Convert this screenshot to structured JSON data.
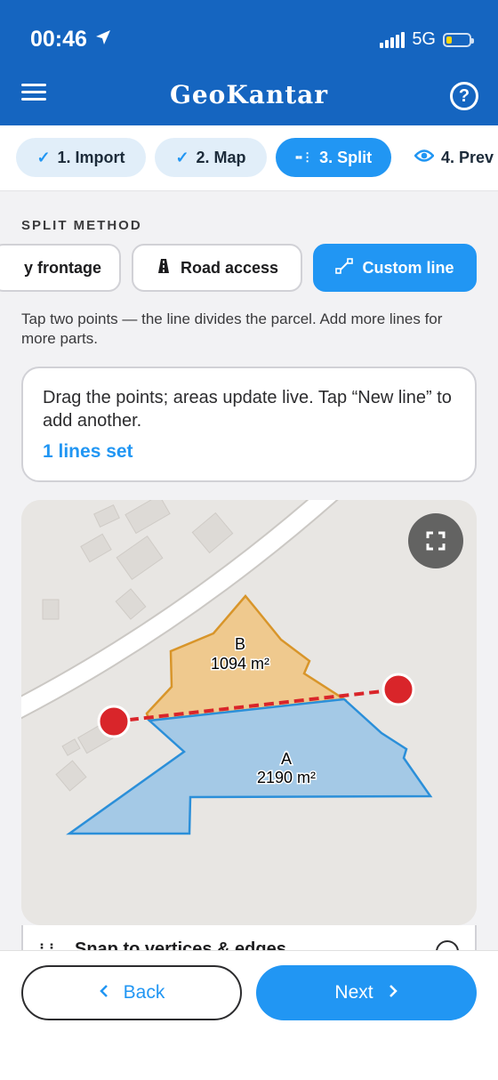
{
  "status": {
    "time": "00:46",
    "network": "5G",
    "location_icon": "location-arrow-icon"
  },
  "header": {
    "title": "GeoKantar",
    "menu_icon": "hamburger-menu-icon",
    "help_icon": "question-circle-icon"
  },
  "steps": [
    {
      "label": "1. Import",
      "state": "done",
      "icon": "check-icon"
    },
    {
      "label": "2. Map",
      "state": "done",
      "icon": "check-icon"
    },
    {
      "label": "3. Split",
      "state": "active",
      "icon": "split-icon"
    },
    {
      "label": "4. Prev",
      "state": "upcoming",
      "icon": "eye-icon"
    }
  ],
  "split_method": {
    "section_label": "SPLIT METHOD",
    "options": [
      {
        "label": "y frontage",
        "state": "inactive"
      },
      {
        "label": "Road access",
        "state": "inactive",
        "icon": "road-icon"
      },
      {
        "label": "Custom line",
        "state": "active",
        "icon": "line-segment-icon"
      }
    ],
    "description": "Tap two points — the line divides the parcel. Add more lines for more parts."
  },
  "info_card": {
    "text": "Drag the points; areas update live. Tap “New line” to add another.",
    "lines_status": "1 lines set"
  },
  "map": {
    "parcels": [
      {
        "label": "B",
        "area": "1094 m²",
        "fill": "#efc98e",
        "stroke": "#d8952a"
      },
      {
        "label": "A",
        "area": "2190 m²",
        "fill": "#a4c9e6",
        "stroke": "#2b8fd9"
      }
    ],
    "split_line_color": "#d9252a",
    "fullscreen_icon": "fullscreen-icon"
  },
  "snap": {
    "label": "Snap to vertices & edges"
  },
  "nav": {
    "back_label": "Back",
    "next_label": "Next"
  },
  "colors": {
    "primary": "#2196f3",
    "header": "#1565c0"
  }
}
